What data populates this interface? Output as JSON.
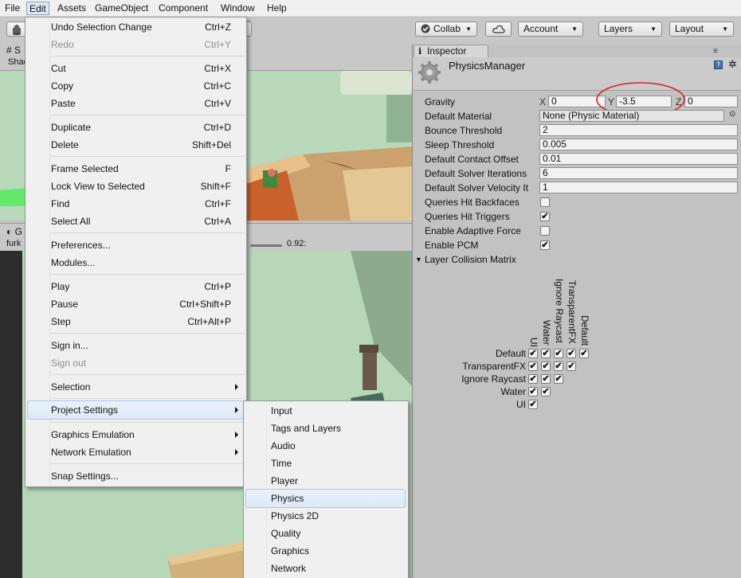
{
  "menubar": {
    "items": [
      "File",
      "Edit",
      "Assets",
      "GameObject",
      "Component",
      "Window",
      "Help"
    ]
  },
  "toolbar": {
    "collab_label": "Collab",
    "account_label": "Account",
    "layers_label": "Layers",
    "layout_label": "Layout"
  },
  "scene": {
    "tab_fragment": "S",
    "shading_fragment": "Shad"
  },
  "game": {
    "tab_fragment": "G",
    "display_fragment": "furk",
    "scale_value": "0.92:"
  },
  "inspector": {
    "tab_label": "Inspector",
    "component_title": "PhysicsManager",
    "gravity": {
      "label": "Gravity",
      "x_axis": "X",
      "x": "0",
      "y_axis": "Y",
      "y": "-3.5",
      "z_axis": "Z",
      "z": "0"
    },
    "default_material": {
      "label": "Default Material",
      "value": "None (Physic Material)"
    },
    "bounce_threshold": {
      "label": "Bounce Threshold",
      "value": "2"
    },
    "sleep_threshold": {
      "label": "Sleep Threshold",
      "value": "0.005"
    },
    "default_contact_offset": {
      "label": "Default Contact Offset",
      "value": "0.01"
    },
    "default_solver_iterations": {
      "label": "Default Solver Iterations",
      "value": "6"
    },
    "default_solver_velocity": {
      "label": "Default Solver Velocity It",
      "value": "1"
    },
    "queries_hit_backfaces": {
      "label": "Queries Hit Backfaces",
      "checked": false
    },
    "queries_hit_triggers": {
      "label": "Queries Hit Triggers",
      "checked": true
    },
    "enable_adaptive_force": {
      "label": "Enable Adaptive Force",
      "checked": false
    },
    "enable_pcm": {
      "label": "Enable PCM",
      "checked": true
    },
    "layer_collision_matrix": {
      "label": "Layer Collision Matrix",
      "rows": [
        "Default",
        "TransparentFX",
        "Ignore Raycast",
        "Water",
        "UI"
      ],
      "columns": [
        "UI",
        "Water",
        "Ignore Raycast",
        "TransparentFX",
        "Default"
      ],
      "check_mark": "✔"
    }
  },
  "edit_menu": {
    "undo": {
      "label": "Undo Selection Change",
      "shortcut": "Ctrl+Z"
    },
    "redo": {
      "label": "Redo",
      "shortcut": "Ctrl+Y"
    },
    "cut": {
      "label": "Cut",
      "shortcut": "Ctrl+X"
    },
    "copy": {
      "label": "Copy",
      "shortcut": "Ctrl+C"
    },
    "paste": {
      "label": "Paste",
      "shortcut": "Ctrl+V"
    },
    "duplicate": {
      "label": "Duplicate",
      "shortcut": "Ctrl+D"
    },
    "delete": {
      "label": "Delete",
      "shortcut": "Shift+Del"
    },
    "frame_selected": {
      "label": "Frame Selected",
      "shortcut": "F"
    },
    "lock_view": {
      "label": "Lock View to Selected",
      "shortcut": "Shift+F"
    },
    "find": {
      "label": "Find",
      "shortcut": "Ctrl+F"
    },
    "select_all": {
      "label": "Select All",
      "shortcut": "Ctrl+A"
    },
    "preferences": {
      "label": "Preferences..."
    },
    "modules": {
      "label": "Modules..."
    },
    "play": {
      "label": "Play",
      "shortcut": "Ctrl+P"
    },
    "pause": {
      "label": "Pause",
      "shortcut": "Ctrl+Shift+P"
    },
    "step": {
      "label": "Step",
      "shortcut": "Ctrl+Alt+P"
    },
    "sign_in": {
      "label": "Sign in..."
    },
    "sign_out": {
      "label": "Sign out"
    },
    "selection": {
      "label": "Selection"
    },
    "project_settings": {
      "label": "Project Settings"
    },
    "graphics_emulation": {
      "label": "Graphics Emulation"
    },
    "network_emulation": {
      "label": "Network Emulation"
    },
    "snap_settings": {
      "label": "Snap Settings..."
    }
  },
  "project_settings_menu": {
    "items": [
      "Input",
      "Tags and Layers",
      "Audio",
      "Time",
      "Player",
      "Physics",
      "Physics 2D",
      "Quality",
      "Graphics",
      "Network"
    ]
  },
  "colors": {
    "highlight_circle": "#d92020",
    "scene_green": "#b8d8ba",
    "menu_bg": "#f0f0f0"
  }
}
